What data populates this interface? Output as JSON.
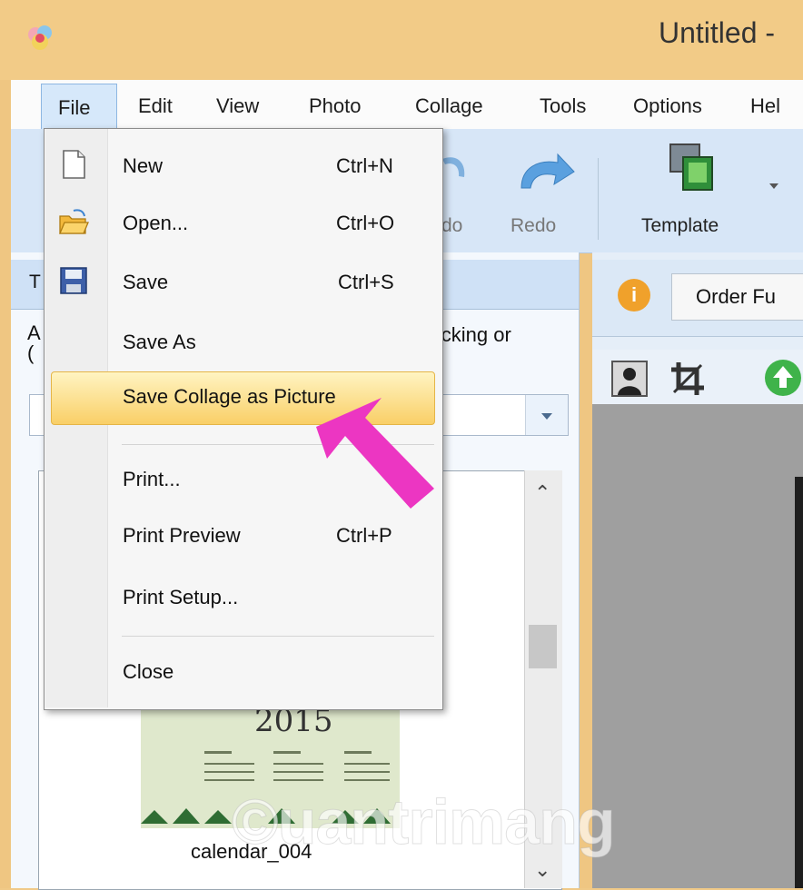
{
  "window": {
    "title": "Untitled -"
  },
  "menubar": {
    "items": [
      {
        "label": "File"
      },
      {
        "label": "Edit"
      },
      {
        "label": "View"
      },
      {
        "label": "Photo"
      },
      {
        "label": "Collage"
      },
      {
        "label": "Tools"
      },
      {
        "label": "Options"
      },
      {
        "label": "Hel"
      }
    ]
  },
  "toolbar": {
    "undo_label": "do",
    "redo_label": "Redo",
    "template_label": "Template"
  },
  "left_panel": {
    "header": "T",
    "note": "clicking or",
    "note_left": "A\n(",
    "selected_item": "calendar_004",
    "thumb_year": "2015"
  },
  "right_panel": {
    "order_button": "Order Fu",
    "info_icon_text": "i"
  },
  "file_menu": {
    "items": [
      {
        "label": "New",
        "shortcut": "Ctrl+N",
        "icon": "new-document-icon"
      },
      {
        "label": "Open...",
        "shortcut": "Ctrl+O",
        "icon": "open-folder-icon"
      },
      {
        "label": "Save",
        "shortcut": "Ctrl+S",
        "icon": "save-disk-icon"
      },
      {
        "label": "Save As",
        "shortcut": "",
        "icon": ""
      },
      {
        "label": "Save Collage as Picture",
        "shortcut": "",
        "icon": "",
        "highlighted": true
      },
      {
        "label": "Print...",
        "shortcut": "",
        "icon": ""
      },
      {
        "label": "Print Preview",
        "shortcut": "Ctrl+P",
        "icon": ""
      },
      {
        "label": "Print Setup...",
        "shortcut": "",
        "icon": ""
      },
      {
        "label": "Close",
        "shortcut": "",
        "icon": ""
      }
    ]
  },
  "watermark": "©uantrimang",
  "colors": {
    "title_bar": "#f2cb87",
    "toolbar": "#d7e6f7",
    "menu_highlight": "#f9cf67",
    "pointer_arrow": "#ec36c2"
  }
}
